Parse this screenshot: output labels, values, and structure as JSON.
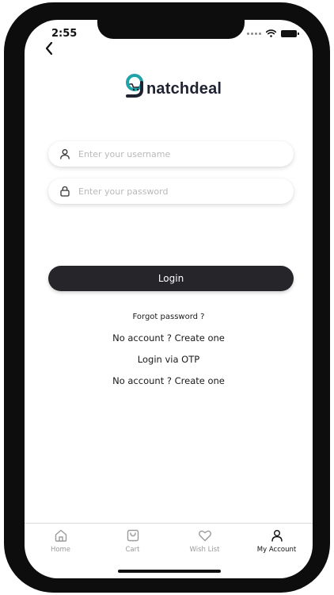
{
  "status_bar": {
    "time": "2:55"
  },
  "brand": {
    "logo_text": "natchdeal"
  },
  "form": {
    "username": {
      "placeholder": "Enter your username",
      "value": ""
    },
    "password": {
      "placeholder": "Enter your password",
      "value": ""
    },
    "login_label": "Login"
  },
  "links": {
    "forgot_password": "Forgot password ?",
    "create_account_1": "No account ? Create one",
    "login_otp": "Login via OTP",
    "create_account_2": "No account ? Create one"
  },
  "bottom_nav": {
    "items": [
      {
        "label": "Home",
        "icon": "home-icon"
      },
      {
        "label": "Cart",
        "icon": "cart-icon"
      },
      {
        "label": "Wish List",
        "icon": "heart-icon"
      },
      {
        "label": "My Account",
        "icon": "user-icon",
        "active": true
      }
    ]
  },
  "colors": {
    "button_bg": "#26262a",
    "logo_teal": "#1fa3a8",
    "logo_dark": "#1f2230",
    "placeholder": "#b9b9b9"
  }
}
